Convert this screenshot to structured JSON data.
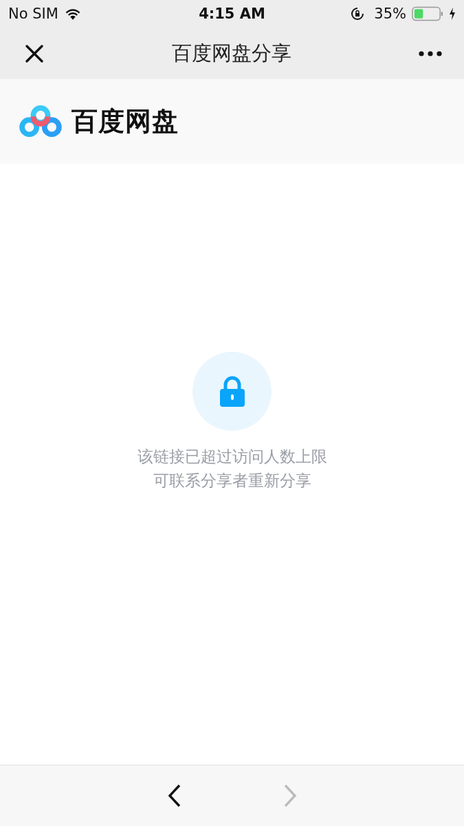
{
  "status_bar": {
    "carrier": "No SIM",
    "time": "4:15 AM",
    "battery": "35%"
  },
  "nav_bar": {
    "title": "百度网盘分享"
  },
  "header": {
    "brand": "百度网盘"
  },
  "message": {
    "lines": [
      "该链接已超过访问人数上限",
      "可联系分享者重新分享"
    ]
  },
  "toolbar": {
    "buttons": [
      {
        "kind": "back",
        "disabled": false
      },
      {
        "kind": "forward",
        "disabled": true
      }
    ]
  }
}
